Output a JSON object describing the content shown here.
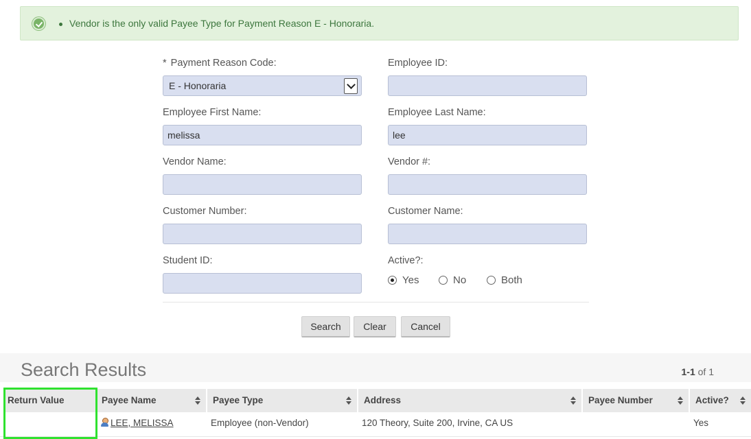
{
  "alert": {
    "message": "Vendor is the only valid Payee Type for Payment Reason E - Honoraria."
  },
  "form": {
    "payment_reason": {
      "required_mark": "*",
      "label": "Payment Reason Code:",
      "value": "E - Honoraria"
    },
    "employee_id": {
      "label": "Employee ID:",
      "value": ""
    },
    "employee_first_name": {
      "label": "Employee First Name:",
      "value": "melissa"
    },
    "employee_last_name": {
      "label": "Employee Last Name:",
      "value": "lee"
    },
    "vendor_name": {
      "label": "Vendor Name:",
      "value": ""
    },
    "vendor_number": {
      "label": "Vendor #:",
      "value": ""
    },
    "customer_number": {
      "label": "Customer Number:",
      "value": ""
    },
    "customer_name": {
      "label": "Customer Name:",
      "value": ""
    },
    "student_id": {
      "label": "Student ID:",
      "value": ""
    },
    "active": {
      "label": "Active?:",
      "options": [
        "Yes",
        "No",
        "Both"
      ],
      "selected": "Yes"
    }
  },
  "buttons": {
    "search": "Search",
    "clear": "Clear",
    "cancel": "Cancel"
  },
  "results": {
    "title": "Search Results",
    "pager_range": "1-1",
    "pager_of": "of 1",
    "columns": [
      "Return Value",
      "Payee Name",
      "Payee Type",
      "Address",
      "Payee Number",
      "Active?"
    ],
    "rows": [
      {
        "return_value": "",
        "payee_name": "LEE, MELISSA",
        "payee_type": "Employee (non-Vendor)",
        "address": "120 Theory, Suite 200, Irvine, CA US",
        "payee_number": "",
        "active": "Yes"
      }
    ]
  },
  "colors": {
    "alert_bg": "#e3f2dd",
    "alert_text": "#3c763d",
    "input_bg": "#d9dff0",
    "highlight": "#2fe22f"
  }
}
